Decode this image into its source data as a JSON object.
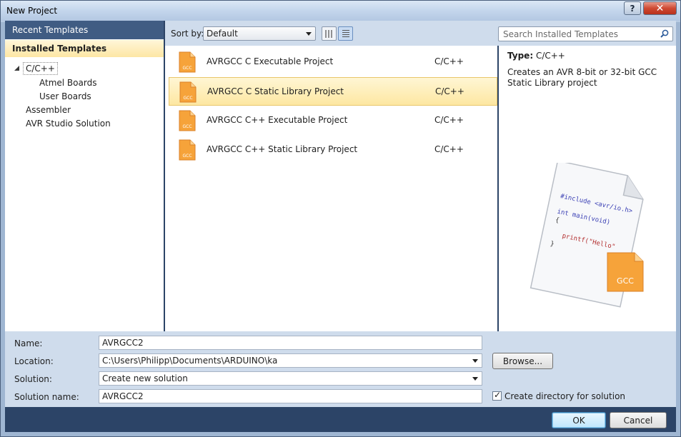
{
  "window": {
    "title": "New Project",
    "help_label": "?",
    "close_label": "✕"
  },
  "sidebar": {
    "recent_label": "Recent Templates",
    "installed_label": "Installed Templates",
    "tree": [
      {
        "label": "C/C++",
        "selected": true,
        "expanded": true
      },
      {
        "label": "Atmel Boards"
      },
      {
        "label": "User Boards"
      },
      {
        "label": "Assembler"
      },
      {
        "label": "AVR Studio Solution"
      }
    ]
  },
  "toolbar": {
    "sort_label": "Sort by:",
    "sort_value": "Default",
    "search_placeholder": "Search Installed Templates"
  },
  "templates": [
    {
      "name": "AVRGCC C Executable Project",
      "lang": "C/C++",
      "icon": "gcc-file-icon"
    },
    {
      "name": "AVRGCC C Static Library Project",
      "lang": "C/C++",
      "icon": "gcc-file-icon",
      "selected": true
    },
    {
      "name": "AVRGCC C++ Executable Project",
      "lang": "C/C++",
      "icon": "gcc-file-icon"
    },
    {
      "name": "AVRGCC C++ Static Library Project",
      "lang": "C/C++",
      "icon": "gcc-file-icon"
    }
  ],
  "detail": {
    "type_label": "Type:",
    "type_value": "C/C++",
    "description": "Creates an AVR 8-bit or 32-bit GCC Static Library project",
    "preview": {
      "line1": "#include <avr/io.h>",
      "line2": "int main(void)",
      "line3": "{",
      "line4": "printf(\"Hello\"",
      "line5": "}",
      "badge": "GCC"
    }
  },
  "form": {
    "name_label": "Name:",
    "name_value": "AVRGCC2",
    "location_label": "Location:",
    "location_value": "C:\\Users\\Philipp\\Documents\\ARDUINO\\ka",
    "browse_label": "Browse...",
    "solution_label": "Solution:",
    "solution_value": "Create new solution",
    "solution_name_label": "Solution name:",
    "solution_name_value": "AVRGCC2",
    "create_dir_label": "Create directory for solution",
    "create_dir_checked": true
  },
  "footer": {
    "ok_label": "OK",
    "cancel_label": "Cancel"
  },
  "colors": {
    "accent": "#2c4467",
    "selection": "#fde7a2",
    "gcc_orange": "#f6a33a"
  }
}
